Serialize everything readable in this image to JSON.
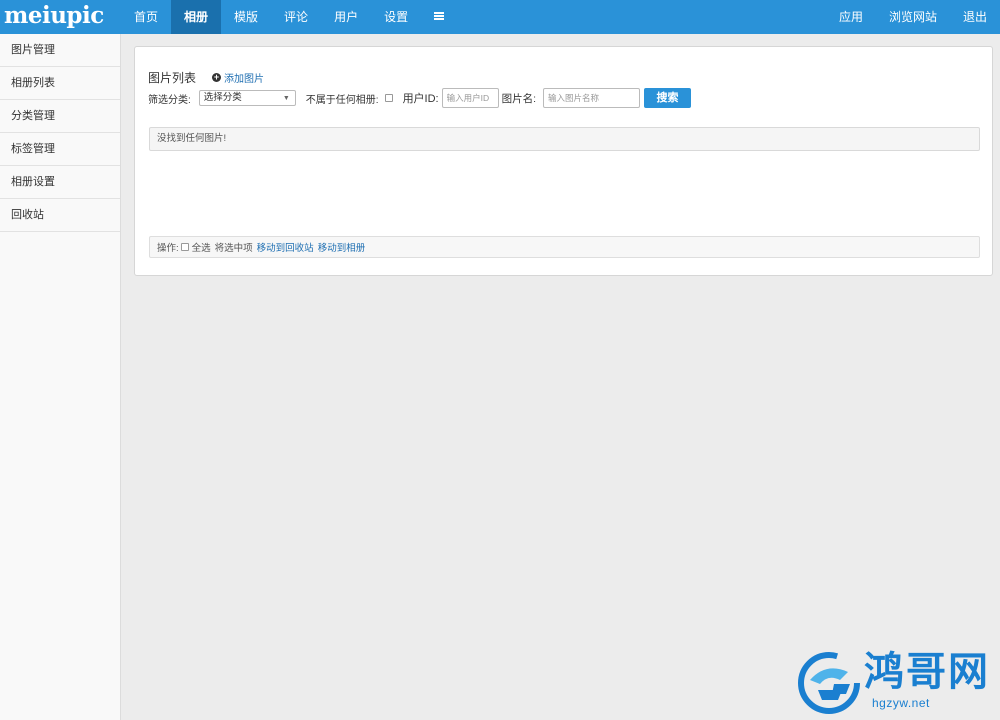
{
  "app": {
    "logo": "meiupic"
  },
  "nav": {
    "items": [
      {
        "label": "首页",
        "active": false
      },
      {
        "label": "相册",
        "active": true
      },
      {
        "label": "模版",
        "active": false
      },
      {
        "label": "评论",
        "active": false
      },
      {
        "label": "用户",
        "active": false
      },
      {
        "label": "设置",
        "active": false
      }
    ],
    "menu_icon": "menu-icon",
    "right": [
      {
        "label": "应用"
      },
      {
        "label": "浏览网站"
      },
      {
        "label": "退出"
      }
    ]
  },
  "sidebar": {
    "items": [
      {
        "label": "图片管理"
      },
      {
        "label": "相册列表"
      },
      {
        "label": "分类管理"
      },
      {
        "label": "标签管理"
      },
      {
        "label": "相册设置"
      },
      {
        "label": "回收站"
      }
    ]
  },
  "panel": {
    "title": "图片列表",
    "add_label": "添加图片",
    "filter": {
      "category_label": "筛选分类:",
      "category_value": "选择分类",
      "not_in_album_label": "不属于任何相册:",
      "userid_label": "用户ID:",
      "userid_placeholder": "输入用户ID",
      "name_label": "图片名:",
      "name_placeholder": "输入图片名称",
      "search_label": "搜索"
    },
    "notice": "没找到任何图片!",
    "ops": {
      "label": "操作:",
      "select_all": "全选",
      "selected_text": "将选中项",
      "move_trash": "移动到回收站",
      "move_album": "移动到相册"
    }
  },
  "watermark": {
    "text": "鸿哥网",
    "url": "hgzyw.net"
  },
  "colors": {
    "primary": "#2a92d8",
    "nav_active": "#1a70ad",
    "link": "#1f6fb2"
  }
}
